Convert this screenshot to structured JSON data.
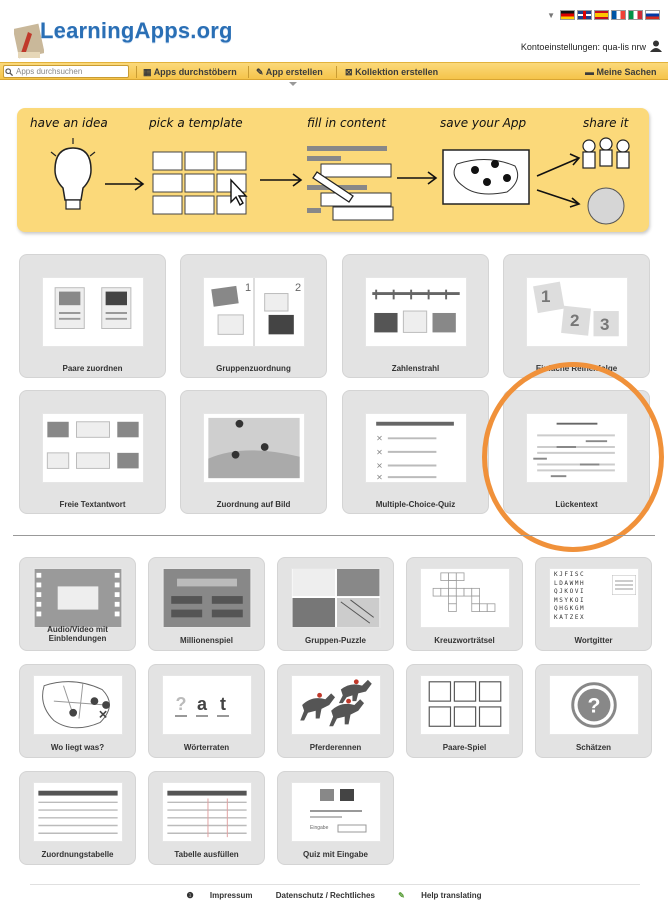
{
  "header": {
    "logo_text": "LearningApps.org",
    "account_label": "Kontoeinstellungen: qua-lis nrw",
    "flags": [
      "de",
      "gb",
      "es",
      "fr",
      "it",
      "ru"
    ]
  },
  "nav": {
    "search_placeholder": "Apps durchsuchen",
    "browse_label": "Apps durchstöbern",
    "create_label": "App erstellen",
    "collection_label": "Kollektion erstellen",
    "my_things_label": "Meine Sachen"
  },
  "banner": {
    "steps": [
      "have an idea",
      "pick a template",
      "fill in content",
      "save your App",
      "share it"
    ]
  },
  "templates_main": [
    {
      "label": "Paare zuordnen"
    },
    {
      "label": "Gruppenzuordnung"
    },
    {
      "label": "Zahlenstrahl"
    },
    {
      "label": "Einfache Reihenfolge"
    },
    {
      "label": "Freie Textantwort"
    },
    {
      "label": "Zuordnung auf Bild"
    },
    {
      "label": "Multiple-Choice-Quiz"
    },
    {
      "label": "Lückentext"
    }
  ],
  "templates_games": [
    {
      "label": "Audio/Video mit Einblendungen"
    },
    {
      "label": "Millionenspiel"
    },
    {
      "label": "Gruppen-Puzzle"
    },
    {
      "label": "Kreuzworträtsel"
    },
    {
      "label": "Wortgitter"
    },
    {
      "label": "Wo liegt was?"
    },
    {
      "label": "Wörterraten"
    },
    {
      "label": "Pferderennen"
    },
    {
      "label": "Paare-Spiel"
    },
    {
      "label": "Schätzen"
    },
    {
      "label": "Zuordnungstabelle"
    },
    {
      "label": "Tabelle ausfüllen"
    },
    {
      "label": "Quiz mit Eingabe"
    }
  ],
  "thumb_text": {
    "group_1": "1",
    "group_2": "2",
    "order_1": "1",
    "order_2": "2",
    "order_3": "3",
    "word_guess": [
      "?",
      "a",
      "t"
    ],
    "wordgrid_rows": [
      "KJFISC",
      "LDAWMH",
      "QJKOVI",
      "MSYKOI",
      "QHGKGM",
      "KATZEX"
    ],
    "quiz_input": "Eingabe"
  },
  "footer": {
    "imprint": "Impressum",
    "privacy": "Datenschutz / Rechtliches",
    "help": "Help translating"
  },
  "colors": {
    "accent": "#f5c44a",
    "banner": "#fbd97a",
    "logo": "#2a6fb5",
    "highlight": "#f0913a",
    "tile": "#e3e3e3"
  }
}
